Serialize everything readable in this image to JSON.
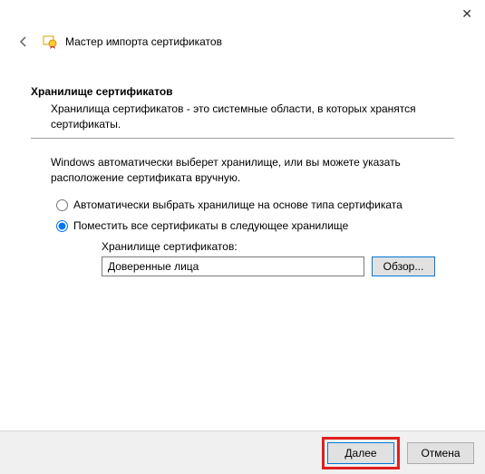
{
  "window": {
    "title": "Мастер импорта сертификатов"
  },
  "section": {
    "heading": "Хранилище сертификатов",
    "description": "Хранилища сертификатов - это системные области, в которых хранятся сертификаты."
  },
  "body": {
    "intro": "Windows автоматически выберет хранилище, или вы можете указать расположение сертификата вручную."
  },
  "radios": {
    "auto": "Автоматически выбрать хранилище на основе типа сертификата",
    "manual": "Поместить все сертификаты в следующее хранилище",
    "selected": "manual"
  },
  "store": {
    "label": "Хранилище сертификатов:",
    "value": "Доверенные лица",
    "browse": "Обзор..."
  },
  "footer": {
    "next": "Далее",
    "cancel": "Отмена"
  }
}
